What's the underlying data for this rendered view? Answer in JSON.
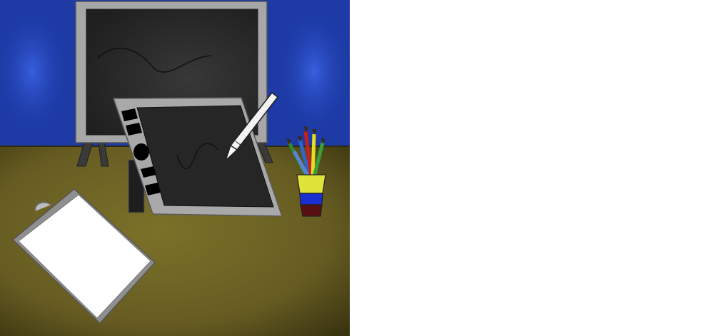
{
  "scene": {
    "description_title": "",
    "colors": {
      "wall": "#1d3aa5",
      "wall_light": "#2f55d6",
      "desk": "#6e6426",
      "desk_dark": "#3f3912",
      "monitor_frame": "#a7a7a7",
      "monitor_screen": "#2d2d2d",
      "tablet_frame": "#a9a9a9",
      "tablet_screen": "#262626",
      "paper": "#ffffff",
      "stylus": "#f2f2f2",
      "cup_yellow": "#e0e33a",
      "cup_blue": "#1a2fd0",
      "cup_maroon": "#5a1012"
    },
    "icons": [
      "monitor-icon",
      "drawing-tablet-icon",
      "stylus-pen-icon",
      "pencil-cup-icon",
      "clipboard-icon"
    ]
  }
}
